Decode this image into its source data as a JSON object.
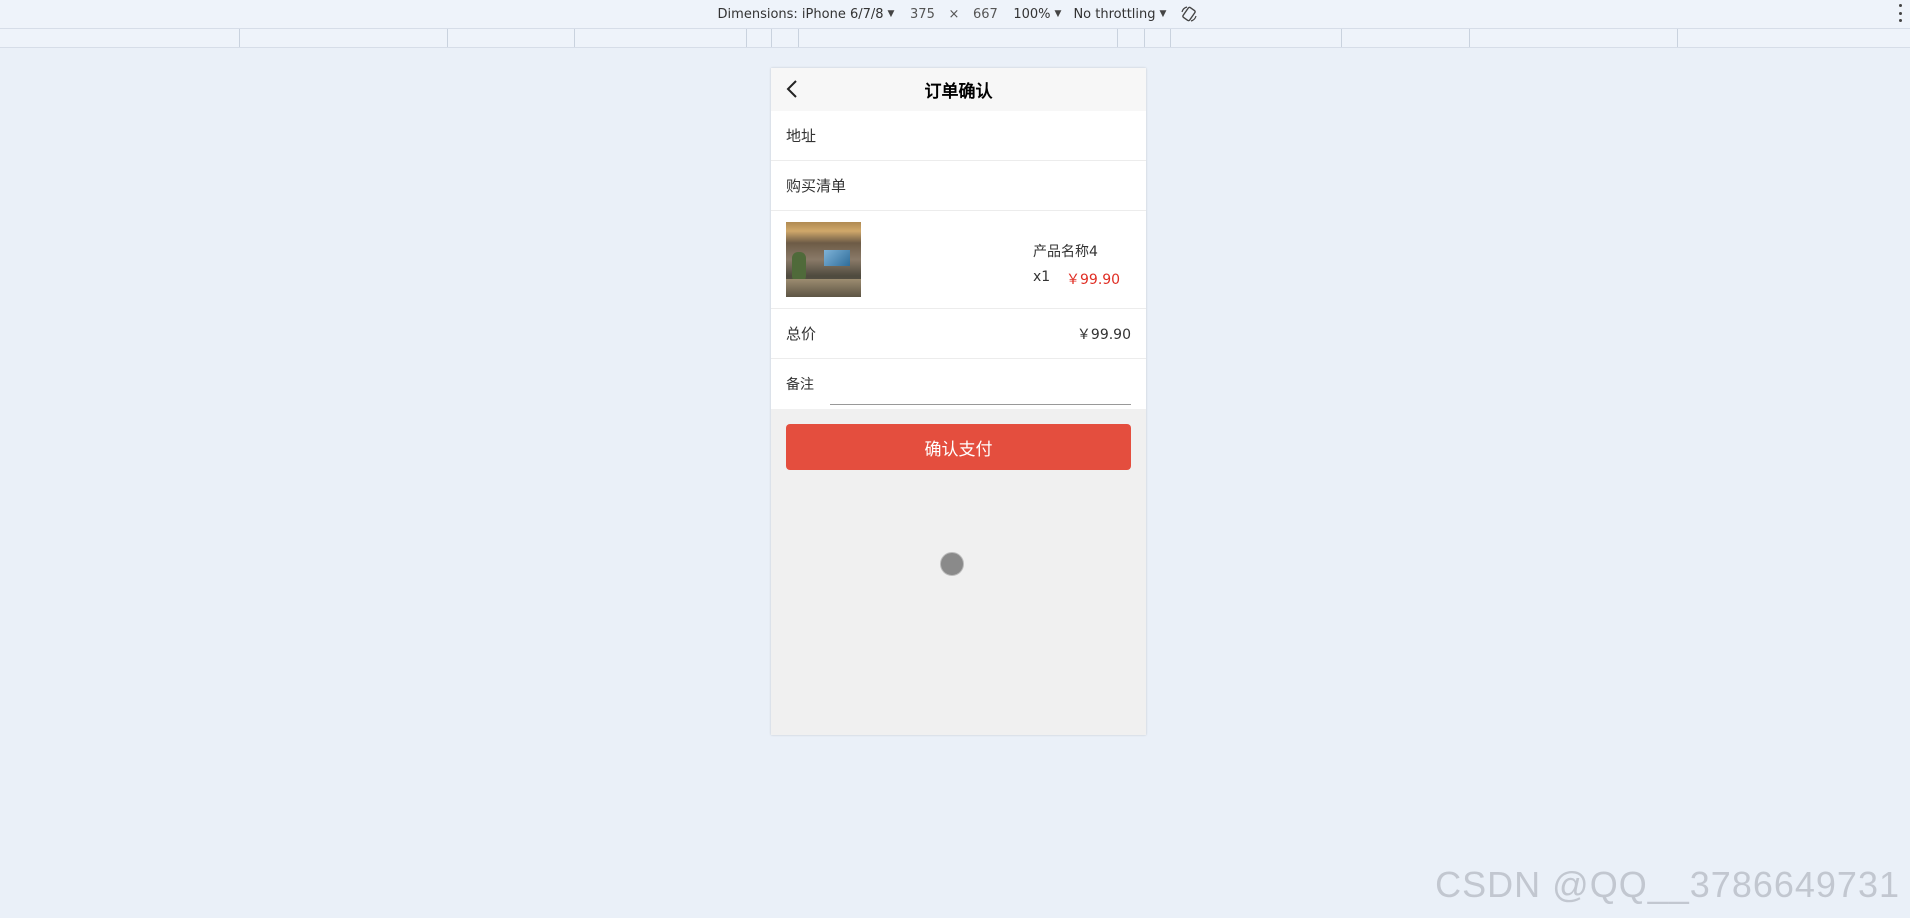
{
  "devtools": {
    "dimensions_label": "Dimensions: iPhone 6/7/8",
    "width": "375",
    "times": "×",
    "height": "667",
    "zoom": "100%",
    "throttling": "No throttling"
  },
  "page": {
    "title": "订单确认",
    "address_label": "地址",
    "list_label": "购买清单",
    "product": {
      "name": "产品名称4",
      "qty": "x1",
      "price": "￥99.90"
    },
    "total_label": "总价",
    "total_value": "￥99.90",
    "remark_label": "备注",
    "remark_value": "",
    "pay_button": "确认支付"
  },
  "watermark": "CSDN @QQ__3786649731",
  "colors": {
    "accent": "#e44e3e",
    "price": "#e02e24",
    "background": "#eaf0f8"
  }
}
